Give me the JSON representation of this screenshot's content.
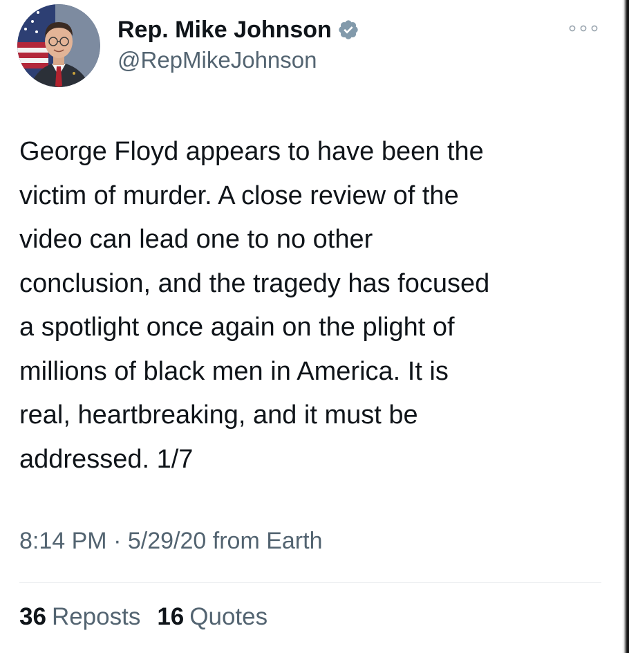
{
  "author": {
    "display_name": "Rep. Mike Johnson",
    "handle": "@RepMikeJohnson",
    "verified": true,
    "avatar_icon": "profile-photo-with-flag"
  },
  "icons": {
    "verified": "verified-badge-icon",
    "more": "more-options-icon"
  },
  "tweet": {
    "text": "George Floyd appears to have been the\nvictim of murder. A close review of the\nvideo can lead one to no other\nconclusion, and the tragedy has focused\na spotlight once again on the plight of\nmillions of black men in America. It is\nreal, heartbreaking, and it must be\naddressed. 1/7"
  },
  "meta": {
    "time": "8:14 PM",
    "separator": "·",
    "date": "5/29/20",
    "source": "from Earth"
  },
  "stats": {
    "reposts_count": "36",
    "reposts_label": "Reposts",
    "quotes_count": "16",
    "quotes_label": "Quotes"
  },
  "colors": {
    "text_primary": "#0f1419",
    "text_secondary": "#536471",
    "verified_badge": "#829aab",
    "divider": "#e6e9ec"
  }
}
